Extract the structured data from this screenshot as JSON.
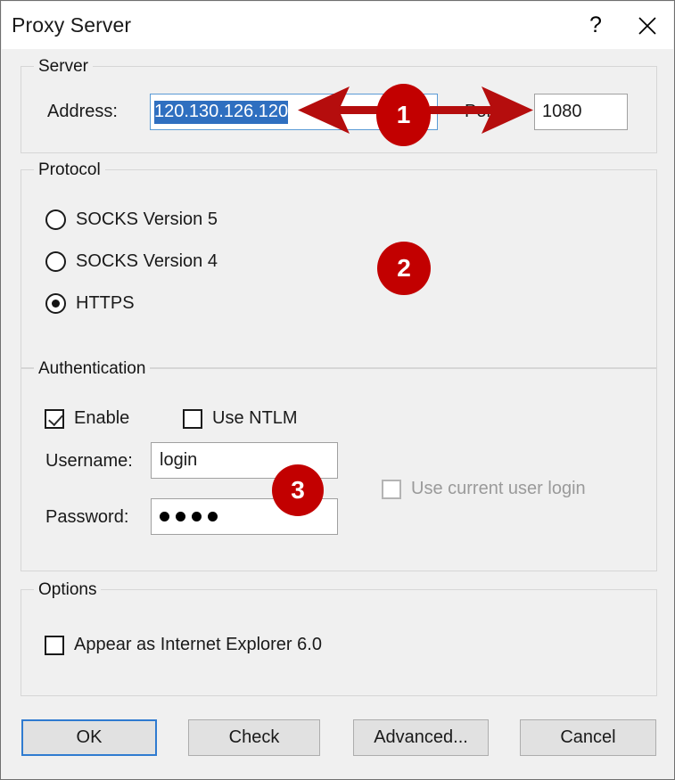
{
  "window": {
    "title": "Proxy Server",
    "help_icon": "question-mark-icon",
    "close_icon": "close-icon"
  },
  "server": {
    "legend": "Server",
    "address_label": "Address:",
    "address_value": "120.130.126.120",
    "port_label": "Port:",
    "port_value": "1080"
  },
  "protocol": {
    "legend": "Protocol",
    "options": [
      {
        "label": "SOCKS Version 5",
        "selected": false
      },
      {
        "label": "SOCKS Version 4",
        "selected": false
      },
      {
        "label": "HTTPS",
        "selected": true
      }
    ]
  },
  "authentication": {
    "legend": "Authentication",
    "enable_label": "Enable",
    "enable_checked": true,
    "ntlm_label": "Use NTLM",
    "ntlm_checked": false,
    "username_label": "Username:",
    "username_value": "login",
    "password_label": "Password:",
    "password_value": "••••",
    "password_dots": 4,
    "current_user_label": "Use current user login",
    "current_user_checked": false,
    "current_user_disabled": true
  },
  "options": {
    "legend": "Options",
    "ie6_label": "Appear as Internet Explorer 6.0",
    "ie6_checked": false
  },
  "buttons": {
    "ok": "OK",
    "check": "Check",
    "advanced": "Advanced...",
    "cancel": "Cancel"
  },
  "annotations": {
    "badge_color": "#c20000",
    "items": [
      {
        "number": "1",
        "target": "address-and-port-fields"
      },
      {
        "number": "2",
        "target": "protocol-group"
      },
      {
        "number": "3",
        "target": "username-and-password-fields"
      }
    ]
  }
}
